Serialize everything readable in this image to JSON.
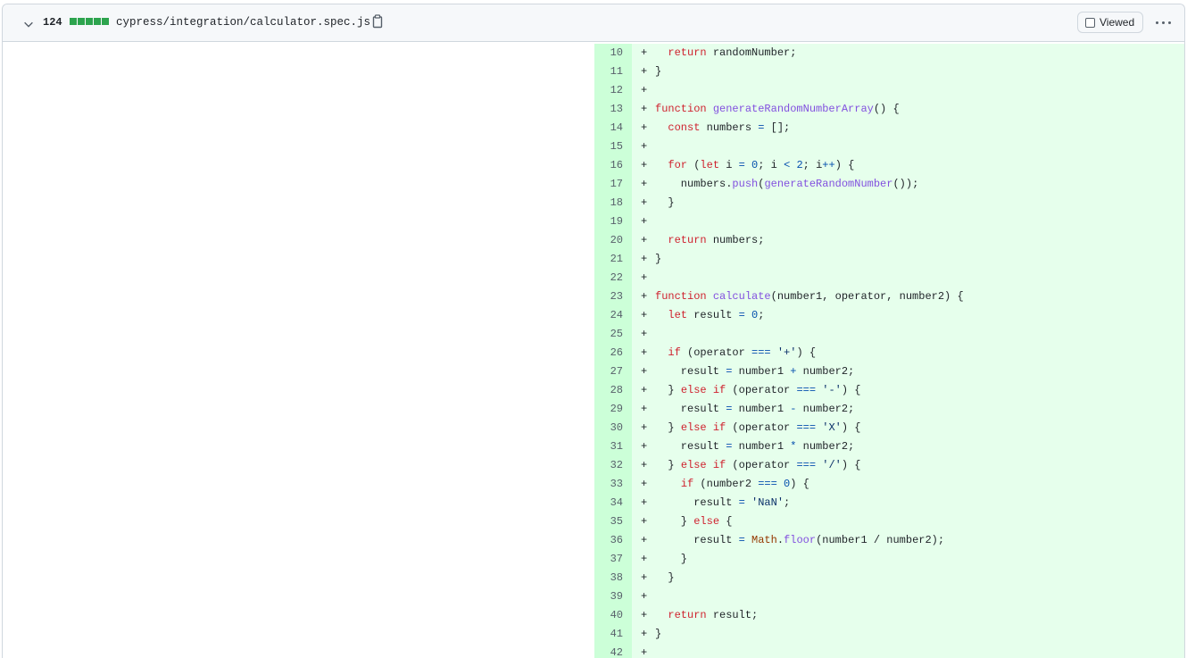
{
  "header": {
    "changes_count": "124",
    "filename": "cypress/integration/calculator.spec.js",
    "viewed_label": "Viewed",
    "diffstat_colors": [
      "#2da44e",
      "#2da44e",
      "#2da44e",
      "#2da44e",
      "#2da44e"
    ]
  },
  "icons": {
    "collapse": "chevron-down-icon",
    "copy": "copy-icon",
    "more": "kebab-horizontal-icon"
  },
  "colors": {
    "added_line_bg": "#e6ffec",
    "added_num_bg": "#ccffd8",
    "keyword": "#cf222e",
    "function": "#8250df",
    "number": "#0550ae"
  },
  "diff": {
    "marker": "+",
    "lines": [
      {
        "num": "10",
        "code": "  return randomNumber;"
      },
      {
        "num": "11",
        "code": "}"
      },
      {
        "num": "12",
        "code": ""
      },
      {
        "num": "13",
        "code": "function generateRandomNumberArray() {"
      },
      {
        "num": "14",
        "code": "  const numbers = [];"
      },
      {
        "num": "15",
        "code": ""
      },
      {
        "num": "16",
        "code": "  for (let i = 0; i < 2; i++) {"
      },
      {
        "num": "17",
        "code": "    numbers.push(generateRandomNumber());"
      },
      {
        "num": "18",
        "code": "  }"
      },
      {
        "num": "19",
        "code": ""
      },
      {
        "num": "20",
        "code": "  return numbers;"
      },
      {
        "num": "21",
        "code": "}"
      },
      {
        "num": "22",
        "code": ""
      },
      {
        "num": "23",
        "code": "function calculate(number1, operator, number2) {"
      },
      {
        "num": "24",
        "code": "  let result = 0;"
      },
      {
        "num": "25",
        "code": ""
      },
      {
        "num": "26",
        "code": "  if (operator === '+') {"
      },
      {
        "num": "27",
        "code": "    result = number1 + number2;"
      },
      {
        "num": "28",
        "code": "  } else if (operator === '-') {"
      },
      {
        "num": "29",
        "code": "    result = number1 - number2;"
      },
      {
        "num": "30",
        "code": "  } else if (operator === 'X') {"
      },
      {
        "num": "31",
        "code": "    result = number1 * number2;"
      },
      {
        "num": "32",
        "code": "  } else if (operator === '/') {"
      },
      {
        "num": "33",
        "code": "    if (number2 === 0) {"
      },
      {
        "num": "34",
        "code": "      result = 'NaN';"
      },
      {
        "num": "35",
        "code": "    } else {"
      },
      {
        "num": "36",
        "code": "      result = Math.floor(number1 / number2);"
      },
      {
        "num": "37",
        "code": "    }"
      },
      {
        "num": "38",
        "code": "  }"
      },
      {
        "num": "39",
        "code": ""
      },
      {
        "num": "40",
        "code": "  return result;"
      },
      {
        "num": "41",
        "code": "}"
      },
      {
        "num": "42",
        "code": ""
      }
    ]
  }
}
